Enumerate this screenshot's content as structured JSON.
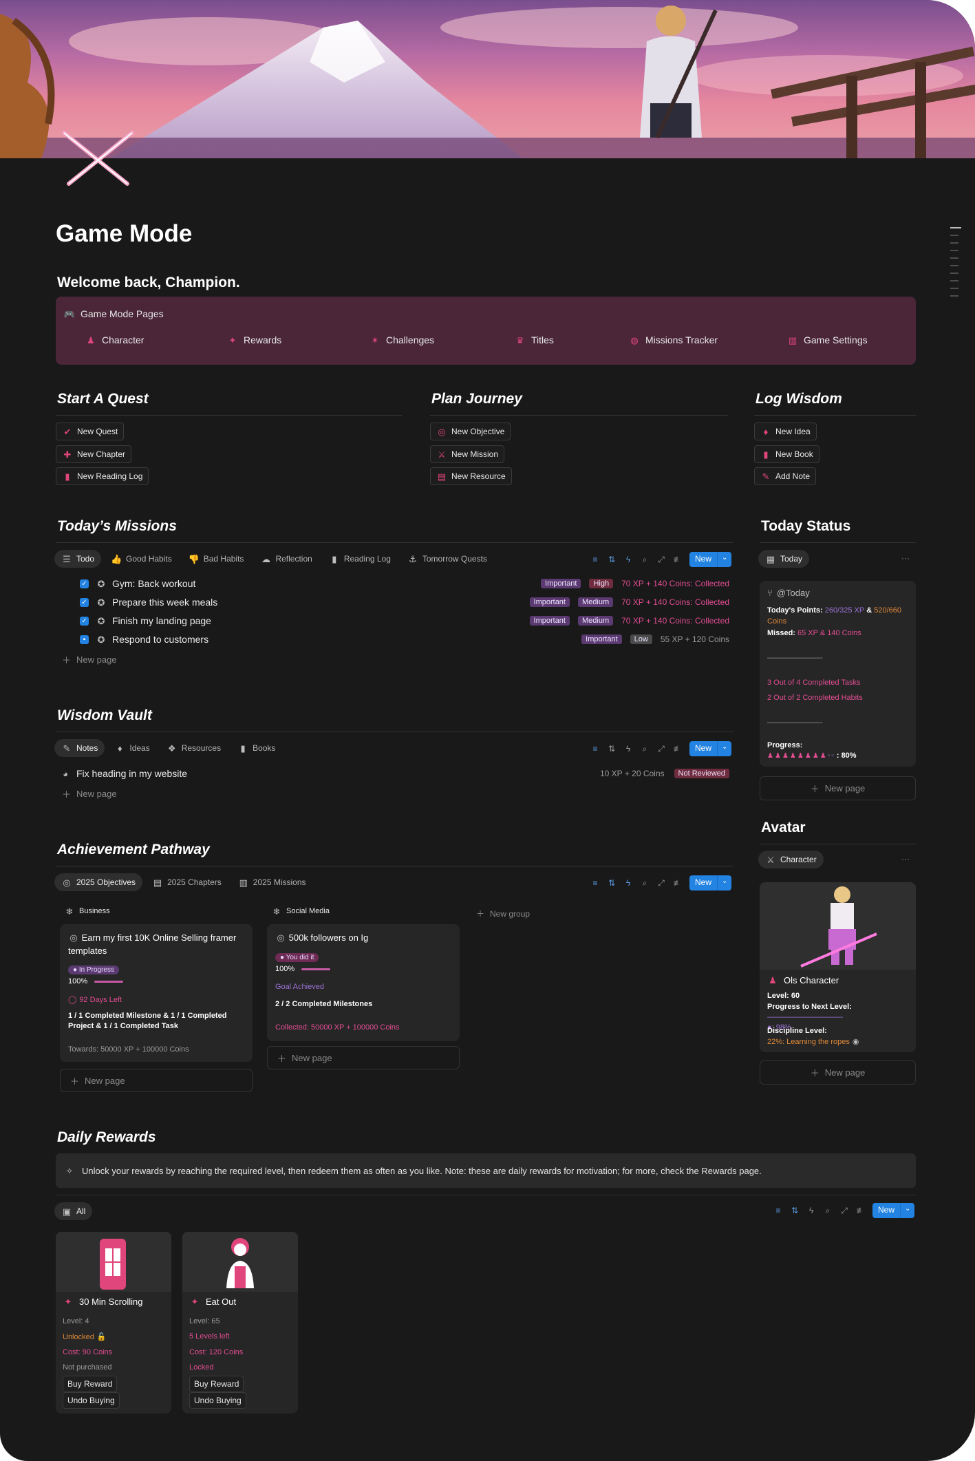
{
  "page": {
    "title": "Game Mode",
    "welcome": "Welcome back, Champion."
  },
  "pages_callout": {
    "title": "Game Mode Pages",
    "items": [
      {
        "label": "Character",
        "icon": "character-icon"
      },
      {
        "label": "Rewards",
        "icon": "rewards-icon"
      },
      {
        "label": "Challenges",
        "icon": "challenges-icon"
      },
      {
        "label": "Titles",
        "icon": "titles-icon"
      },
      {
        "label": "Missions Tracker",
        "icon": "missions-tracker-icon"
      },
      {
        "label": "Game Settings",
        "icon": "game-settings-icon"
      }
    ]
  },
  "quick_sections": [
    {
      "title": "Start A Quest",
      "buttons": [
        "New Quest",
        "New Chapter",
        "New Reading Log"
      ]
    },
    {
      "title": "Plan Journey",
      "buttons": [
        "New Objective",
        "New Mission",
        "New Resource"
      ]
    },
    {
      "title": "Log Wisdom",
      "buttons": [
        "New Idea",
        "New Book",
        "Add Note"
      ]
    }
  ],
  "toolbar": {
    "new_label": "New"
  },
  "todays_missions": {
    "title": "Today’s Missions",
    "tabs": [
      "Todo",
      "Good Habits",
      "Bad Habits",
      "Reflection",
      "Reading Log",
      "Tomorrow Quests"
    ],
    "rows": [
      {
        "name": "Gym: Back workout",
        "priority": "Important",
        "level": "High",
        "reward": "70 XP + 140 Coins: Collected"
      },
      {
        "name": "Prepare this week meals",
        "priority": "Important",
        "level": "Medium",
        "reward": "70 XP + 140 Coins: Collected"
      },
      {
        "name": "Finish my landing page",
        "priority": "Important",
        "level": "Medium",
        "reward": "70 XP + 140 Coins: Collected"
      },
      {
        "name": "Respond to customers",
        "priority": "Important",
        "level": "Low",
        "reward": "55 XP + 120 Coins"
      }
    ],
    "new_page": "New page"
  },
  "today_status": {
    "title": "Today Status",
    "tab": "Today",
    "more": "···",
    "card_title": "@Today",
    "points_label": "Today's Points: ",
    "points_xp": "260/325 XP",
    "points_amp": " & ",
    "points_coins": "520/660 Coins",
    "missed_label": "Missed: ",
    "missed_value": "65 XP & 140 Coins",
    "divider1": "———————-",
    "tasks": "3 Out of 4 Completed Tasks",
    "habits": "2 Out of 2 Completed Habits",
    "divider2": "———————-",
    "progress_label": "Progress:",
    "progress_value": ": 80%",
    "progress_percent": 80,
    "new_page": "New page"
  },
  "wisdom_vault": {
    "title": "Wisdom Vault",
    "tabs": [
      "Notes",
      "Ideas",
      "Resources",
      "Books"
    ],
    "rows": [
      {
        "name": "Fix heading in my website",
        "reward": "10 XP + 20 Coins",
        "status": "Not Reviewed"
      }
    ],
    "new_page": "New page"
  },
  "avatar": {
    "title": "Avatar",
    "tab": "Character",
    "more": "···",
    "name": "Ols Character",
    "level": "Level: 60",
    "progress_label": "Progress to Next Level: ",
    "progress_dashes": "——————————",
    "progress_value": ": 98%",
    "progress_percent": 98,
    "discipline_label": "Discipline Level:",
    "discipline_value": "22%: Learning the ropes",
    "new_page": "New page"
  },
  "achievement": {
    "title": "Achievement Pathway",
    "tabs": [
      "2025 Objectives",
      "2025 Chapters",
      "2025 Missions"
    ],
    "groups": [
      {
        "name": "Business",
        "card": {
          "title": "Earn my first 10K Online Selling framer templates",
          "status": "In Progress",
          "percent_label": "100%",
          "days_left": "92 Days Left",
          "summary": "1 / 1 Completed Milestone & 1 / 1 Completed Project & 1 / 1 Completed Task",
          "towards": "Towards: 50000 XP + 100000 Coins"
        }
      },
      {
        "name": "Social Media",
        "card": {
          "title": "500k followers on Ig",
          "status": "You did it",
          "percent_label": "100%",
          "goal": "Goal Achieved",
          "summary": "2 / 2 Completed Milestones",
          "collected": "Collected: 50000 XP + 100000 Coins"
        }
      }
    ],
    "new_group": "New group",
    "new_page": "New page"
  },
  "daily_rewards": {
    "title": "Daily Rewards",
    "note": "Unlock your rewards by reaching the required level, then redeem them as often as you like. Note: these are daily rewards for motivation; for more, check the Rewards page.",
    "tab": "All",
    "cards": [
      {
        "name": "30 Min Scrolling",
        "level": "Level: 4",
        "state": "Unlocked",
        "cost": "Cost: 90 Coins",
        "purchase": "Not purchased",
        "buy": "Buy Reward",
        "undo": "Undo Buying"
      },
      {
        "name": "Eat Out",
        "level": "Level: 65",
        "state": "5 Levels left",
        "cost": "Cost: 120 Coins",
        "purchase": "Locked",
        "buy": "Buy Reward",
        "undo": "Undo Buying"
      }
    ]
  },
  "colors": {
    "accent": "#2383e2",
    "pink": "#e24d93",
    "callout": "#4a2638",
    "background": "#191919"
  }
}
